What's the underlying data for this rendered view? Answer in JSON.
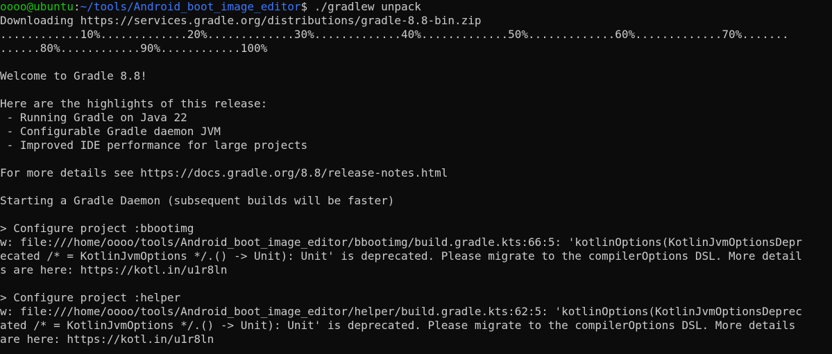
{
  "window": {
    "colors": {
      "background": "#0c0c0c",
      "foreground": "#cccccc",
      "prompt_user": "#16c60c",
      "prompt_path": "#3b78ff"
    }
  },
  "prompt": {
    "user_host": "oooo@ubuntu",
    "separator": ":",
    "path": "~/tools/Android_boot_image_editor",
    "symbol": "$ ",
    "command": "./gradlew unpack"
  },
  "output": [
    "Downloading https://services.gradle.org/distributions/gradle-8.8-bin.zip",
    "............10%.............20%.............30%.............40%.............50%.............60%.............70%.......",
    "......80%............90%............100%",
    "",
    "Welcome to Gradle 8.8!",
    "",
    "Here are the highlights of this release:",
    " - Running Gradle on Java 22",
    " - Configurable Gradle daemon JVM",
    " - Improved IDE performance for large projects",
    "",
    "For more details see https://docs.gradle.org/8.8/release-notes.html",
    "",
    "Starting a Gradle Daemon (subsequent builds will be faster)",
    "",
    "> Configure project :bbootimg",
    "w: file:///home/oooo/tools/Android_boot_image_editor/bbootimg/build.gradle.kts:66:5: 'kotlinOptions(KotlinJvmOptionsDepr",
    "ecated /* = KotlinJvmOptions */.() -> Unit): Unit' is deprecated. Please migrate to the compilerOptions DSL. More detail",
    "s are here: https://kotl.in/u1r8ln",
    "",
    "> Configure project :helper",
    "w: file:///home/oooo/tools/Android_boot_image_editor/helper/build.gradle.kts:62:5: 'kotlinOptions(KotlinJvmOptionsDeprec",
    "ated /* = KotlinJvmOptions */.() -> Unit): Unit' is deprecated. Please migrate to the compilerOptions DSL. More details",
    "are here: https://kotl.in/u1r8ln"
  ]
}
